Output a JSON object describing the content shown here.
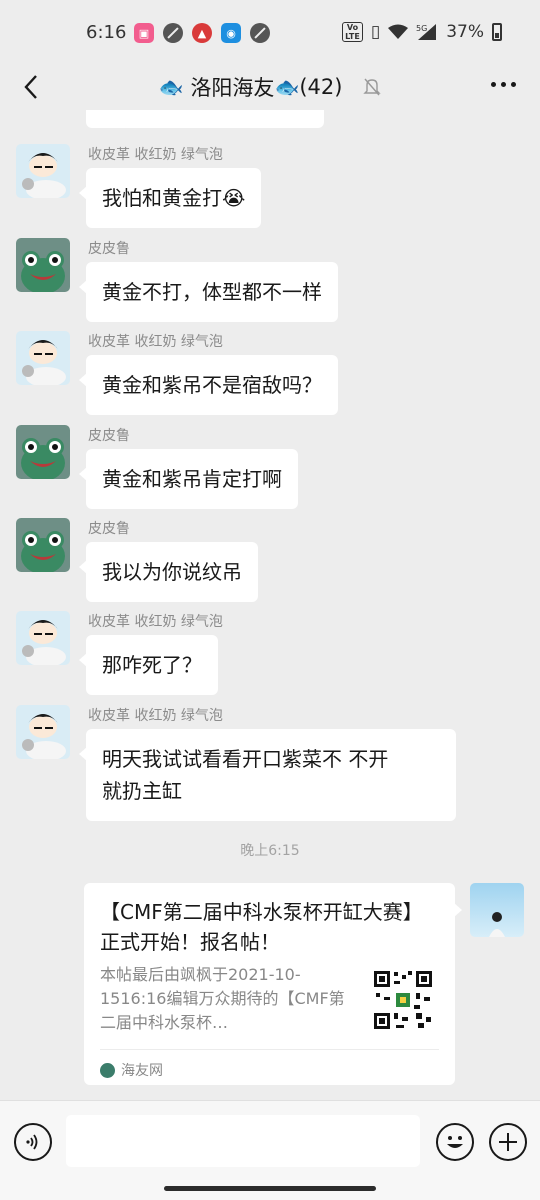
{
  "status_bar": {
    "time": "6:16",
    "battery": "37%",
    "network": "5G",
    "app_icons": [
      "bilibili-icon",
      "circle-icon",
      "app-red-icon",
      "app-blue-icon",
      "circle-icon"
    ]
  },
  "header": {
    "title_prefix_emoji": "🐟",
    "title": "洛阳海友",
    "title_suffix_emoji": "🐟",
    "member_count": "(42)"
  },
  "messages": [
    {
      "sender": "收皮革 收红奶 绿气泡",
      "text": "我怕和黄金打😭",
      "avatar": "cartoon-boy-avatar"
    },
    {
      "sender": "皮皮鲁",
      "text": "黄金不打，体型都不一样",
      "avatar": "green-frog-avatar"
    },
    {
      "sender": "收皮革 收红奶 绿气泡",
      "text": "黄金和紫吊不是宿敌吗？",
      "avatar": "cartoon-boy-avatar"
    },
    {
      "sender": "皮皮鲁",
      "text": "黄金和紫吊肯定打啊",
      "avatar": "green-frog-avatar"
    },
    {
      "sender": "皮皮鲁",
      "text": "我以为你说纹吊",
      "avatar": "green-frog-avatar"
    },
    {
      "sender": "收皮革 收红奶 绿气泡",
      "text": "那咋死了？",
      "avatar": "cartoon-boy-avatar"
    },
    {
      "sender": "收皮革 收红奶 绿气泡",
      "text_line1": "明天我试试看看开口紫菜不 不开",
      "text_line2": "就扔主缸",
      "avatar": "cartoon-boy-avatar"
    }
  ],
  "timestamp": "晚上6:15",
  "link_card": {
    "title": "【CMF第二届中科水泵杯开缸大赛】正式开始！报名帖！",
    "description": "本帖最后由飒枫于2021-10-1516:16编辑万众期待的【CMF第二届中科水泵杯…",
    "source": "海友网"
  },
  "colors": {
    "background": "#ededed",
    "bubble": "#ffffff",
    "text": "#191919",
    "meta": "#8c8c8c"
  }
}
